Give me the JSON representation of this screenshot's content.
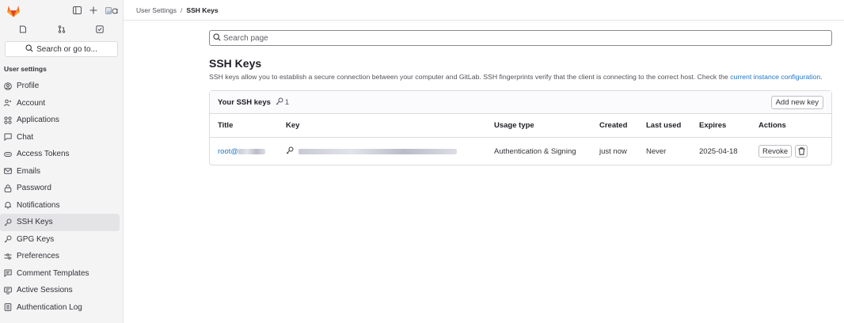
{
  "colors": {
    "accent": "#1f75cb",
    "brand": "#e24329",
    "sidebar_bg": "#f4f4f5"
  },
  "sidebar": {
    "search_label": "Search or go to...",
    "section_title": "User settings",
    "items": [
      {
        "label": "Profile",
        "icon": "profile-icon"
      },
      {
        "label": "Account",
        "icon": "account-icon"
      },
      {
        "label": "Applications",
        "icon": "applications-icon"
      },
      {
        "label": "Chat",
        "icon": "chat-icon"
      },
      {
        "label": "Access Tokens",
        "icon": "token-icon"
      },
      {
        "label": "Emails",
        "icon": "mail-icon"
      },
      {
        "label": "Password",
        "icon": "lock-icon"
      },
      {
        "label": "Notifications",
        "icon": "bell-icon"
      },
      {
        "label": "SSH Keys",
        "icon": "key-icon"
      },
      {
        "label": "GPG Keys",
        "icon": "key-icon"
      },
      {
        "label": "Preferences",
        "icon": "preferences-icon"
      },
      {
        "label": "Comment Templates",
        "icon": "comment-icon"
      },
      {
        "label": "Active Sessions",
        "icon": "sessions-icon"
      },
      {
        "label": "Authentication Log",
        "icon": "log-icon"
      }
    ]
  },
  "breadcrumb": {
    "parent": "User Settings",
    "separator": "/",
    "current": "SSH Keys"
  },
  "main": {
    "search_placeholder": "Search page",
    "title": "SSH Keys",
    "description": "SSH keys allow you to establish a secure connection between your computer and GitLab. SSH fingerprints verify that the client is connecting to the correct host. Check the",
    "description_link": "current instance configuration",
    "description_end": "."
  },
  "keys_card": {
    "title": "Your SSH keys",
    "count": "1",
    "add_button": "Add new key",
    "columns": [
      "Title",
      "Key",
      "Usage type",
      "Created",
      "Last used",
      "Expires",
      "Actions"
    ],
    "rows": [
      {
        "title": "root@",
        "usage": "Authentication & Signing",
        "created": "just now",
        "last_used": "Never",
        "expires": "2025-04-18",
        "revoke": "Revoke"
      }
    ]
  }
}
